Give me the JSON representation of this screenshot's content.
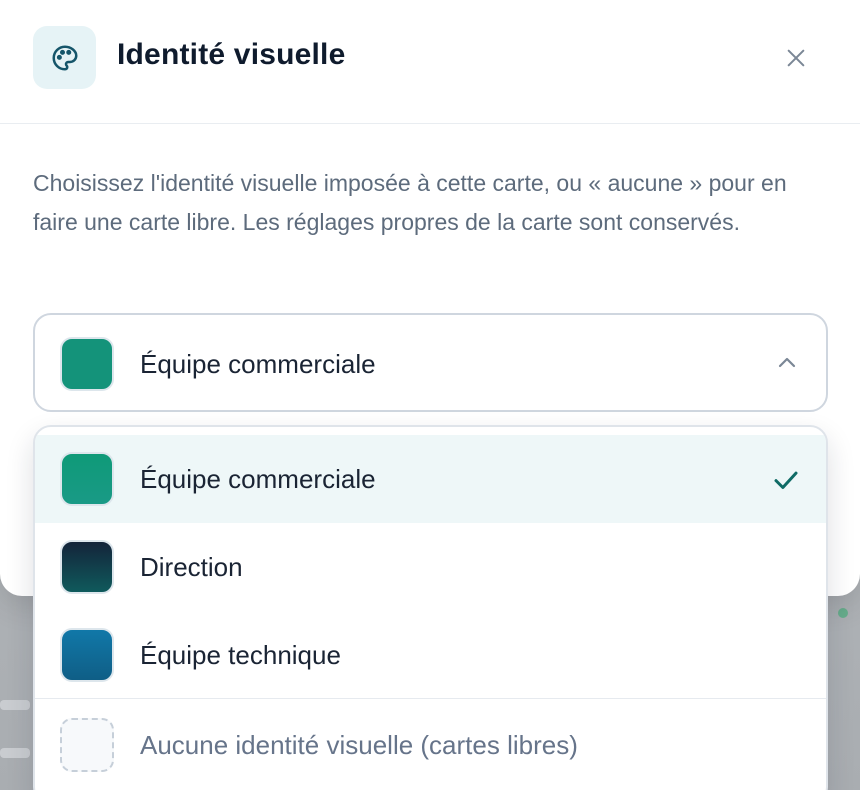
{
  "modal": {
    "title": "Identité visuelle",
    "description": "Choisissez l'identité visuelle imposée à cette carte, ou « aucune » pour en faire une carte libre. Les réglages propres de la carte sont conservés.",
    "header_icon": "palette-icon",
    "close_icon": "close-icon"
  },
  "select": {
    "selected_label": "Équipe commerciale",
    "selected_color": "#14937a",
    "chevron_icon": "chevron-up-icon"
  },
  "options": [
    {
      "label": "Équipe commerciale",
      "gradient": [
        "#0f9a78",
        "#199a86"
      ],
      "selected": true
    },
    {
      "label": "Direction",
      "gradient": [
        "#14243a",
        "#0f5a5c"
      ],
      "selected": false
    },
    {
      "label": "Équipe technique",
      "gradient": [
        "#1178a8",
        "#0f5e86"
      ],
      "selected": false
    },
    {
      "label": "Aucune identité visuelle (cartes libres)",
      "gradient": null,
      "selected": false
    }
  ],
  "colors": {
    "accent": "#0f6b66",
    "selected_bg": "#eef7f8"
  }
}
